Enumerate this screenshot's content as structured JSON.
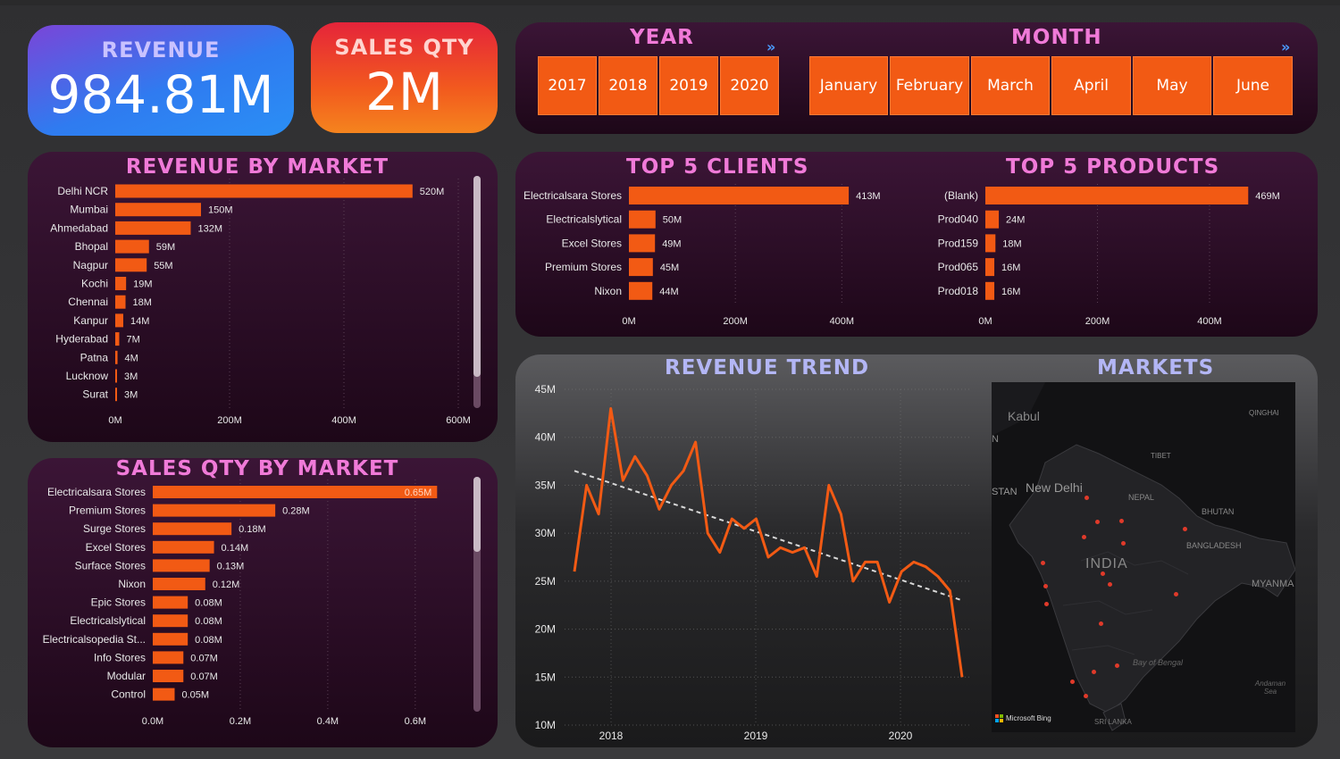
{
  "colors": {
    "bar": "#f25a14",
    "pink_title": "#f07ad8",
    "blue_title": "#b3b6f5",
    "grid": "#5a4055"
  },
  "kpis": {
    "revenue": {
      "label": "REVENUE",
      "value": "984.81M"
    },
    "sales_qty": {
      "label": "SALES QTY",
      "value": "2M"
    }
  },
  "slicers": {
    "year": {
      "title": "YEAR",
      "options": [
        "2017",
        "2018",
        "2019",
        "2020"
      ],
      "chevron": "»"
    },
    "month": {
      "title": "MONTH",
      "options": [
        "January",
        "February",
        "March",
        "April",
        "May",
        "June"
      ],
      "chevron": "»"
    }
  },
  "titles": {
    "revenue_by_market": "REVENUE BY MARKET",
    "sales_qty_by_market": "SALES QTY BY MARKET",
    "top5_clients": "TOP 5 CLIENTS",
    "top5_products": "TOP 5 PRODUCTS",
    "revenue_trend": "REVENUE TREND",
    "markets": "MARKETS"
  },
  "map_labels": {
    "kabul": "Kabul",
    "qinghai": "QINGHAI",
    "tibet": "TIBET",
    "stan": "STAN",
    "new_delhi": "New Delhi",
    "nepal": "NEPAL",
    "bhutan": "BHUTAN",
    "bangladesh": "BANGLADESH",
    "india": "INDIA",
    "myanmar": "MYANMA",
    "bay": "Bay of Bengal",
    "andaman": "Andaman Sea",
    "srilanka": "SRI LANKA",
    "bing": "Microsoft Bing",
    "n": "N"
  },
  "chart_data": [
    {
      "id": "revenue_by_market",
      "type": "bar",
      "orientation": "horizontal",
      "title": "REVENUE BY MARKET",
      "categories": [
        "Delhi NCR",
        "Mumbai",
        "Ahmedabad",
        "Bhopal",
        "Nagpur",
        "Kochi",
        "Chennai",
        "Kanpur",
        "Hyderabad",
        "Patna",
        "Lucknow",
        "Surat"
      ],
      "values": [
        520,
        150,
        132,
        59,
        55,
        19,
        18,
        14,
        7,
        4,
        3,
        3
      ],
      "data_labels": [
        "520M",
        "150M",
        "132M",
        "59M",
        "55M",
        "19M",
        "18M",
        "14M",
        "7M",
        "4M",
        "3M",
        "3M"
      ],
      "xlim": [
        0,
        600
      ],
      "x_ticks": [
        0,
        200,
        400,
        600
      ],
      "x_tick_labels": [
        "0M",
        "200M",
        "400M",
        "600M"
      ]
    },
    {
      "id": "sales_qty_by_market",
      "type": "bar",
      "orientation": "horizontal",
      "title": "SALES QTY BY MARKET",
      "categories": [
        "Electricalsara Stores",
        "Premium Stores",
        "Surge Stores",
        "Excel Stores",
        "Surface Stores",
        "Nixon",
        "Epic Stores",
        "Electricalslytical",
        "Electricalsopedia St...",
        "Info Stores",
        "Modular",
        "Control"
      ],
      "values": [
        0.65,
        0.28,
        0.18,
        0.14,
        0.13,
        0.12,
        0.08,
        0.08,
        0.08,
        0.07,
        0.07,
        0.05
      ],
      "data_labels": [
        "0.65M",
        "0.28M",
        "0.18M",
        "0.14M",
        "0.13M",
        "0.12M",
        "0.08M",
        "0.08M",
        "0.08M",
        "0.07M",
        "0.07M",
        "0.05M"
      ],
      "xlim": [
        0,
        0.68
      ],
      "x_ticks": [
        0,
        0.2,
        0.4,
        0.6
      ],
      "x_tick_labels": [
        "0.0M",
        "0.2M",
        "0.4M",
        "0.6M"
      ]
    },
    {
      "id": "top5_clients",
      "type": "bar",
      "orientation": "horizontal",
      "title": "TOP 5 CLIENTS",
      "categories": [
        "Electricalsara Stores",
        "Electricalslytical",
        "Excel Stores",
        "Premium Stores",
        "Nixon"
      ],
      "values": [
        413,
        50,
        49,
        45,
        44
      ],
      "data_labels": [
        "413M",
        "50M",
        "49M",
        "45M",
        "44M"
      ],
      "xlim": [
        0,
        480
      ],
      "x_ticks": [
        0,
        200,
        400
      ],
      "x_tick_labels": [
        "0M",
        "200M",
        "400M"
      ]
    },
    {
      "id": "top5_products",
      "type": "bar",
      "orientation": "horizontal",
      "title": "TOP 5 PRODUCTS",
      "categories": [
        "(Blank)",
        "Prod040",
        "Prod159",
        "Prod065",
        "Prod018"
      ],
      "values": [
        469,
        24,
        18,
        16,
        16
      ],
      "data_labels": [
        "469M",
        "24M",
        "18M",
        "16M",
        "16M"
      ],
      "xlim": [
        0,
        510
      ],
      "x_ticks": [
        0,
        200,
        400
      ],
      "x_tick_labels": [
        "0M",
        "200M",
        "400M"
      ]
    },
    {
      "id": "revenue_trend",
      "type": "line",
      "title": "REVENUE TREND",
      "x": [
        "2017-06",
        "2017-07",
        "2017-08",
        "2017-09",
        "2017-10",
        "2017-11",
        "2017-12",
        "2018-01",
        "2018-02",
        "2018-03",
        "2018-04",
        "2018-05",
        "2018-06",
        "2018-07",
        "2018-08",
        "2018-09",
        "2018-10",
        "2018-11",
        "2018-12",
        "2019-01",
        "2019-02",
        "2019-03",
        "2019-04",
        "2019-05",
        "2019-06",
        "2019-07",
        "2019-08",
        "2019-09",
        "2019-10",
        "2019-11",
        "2019-12",
        "2020-01",
        "2020-02",
        "2020-03",
        "2020-04",
        "2020-05",
        "2020-06"
      ],
      "series": [
        {
          "values": [
            26,
            35,
            32,
            43,
            35.5,
            38,
            36,
            32.5,
            35,
            36.5,
            39.5,
            30,
            28,
            31.5,
            30.5,
            31.5,
            27.5,
            28.5,
            28,
            28.5,
            25.5,
            35,
            32,
            25,
            27,
            27,
            22.8,
            26,
            27,
            26.5,
            25.5,
            24,
            15
          ]
        }
      ],
      "trend_line": {
        "start": 36.5,
        "end": 23
      },
      "ylim": [
        10,
        45
      ],
      "y_ticks": [
        10,
        15,
        20,
        25,
        30,
        35,
        40,
        45
      ],
      "y_tick_labels": [
        "10M",
        "15M",
        "20M",
        "25M",
        "30M",
        "35M",
        "40M",
        "45M"
      ],
      "x_tick_labels": [
        "2018",
        "2019",
        "2020"
      ]
    }
  ]
}
